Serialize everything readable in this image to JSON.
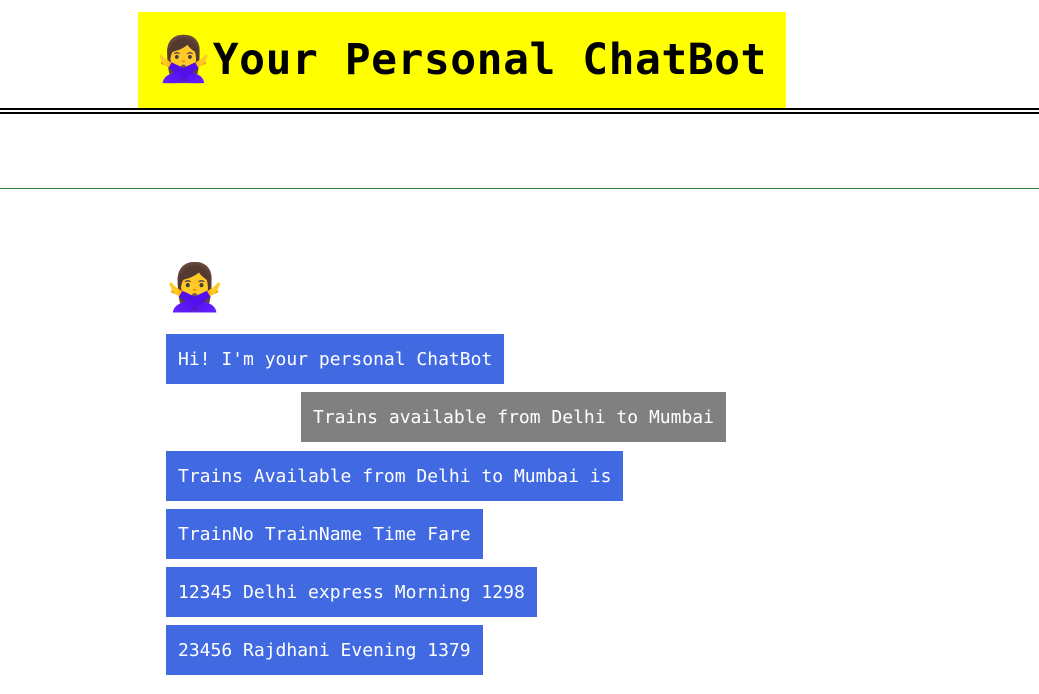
{
  "header": {
    "emoji": "🙅‍♀️",
    "title": "Your Personal ChatBot",
    "background_color": "#ffff00"
  },
  "chat": {
    "bot_avatar": "🙅‍♀️",
    "bot_bubble_color": "#4169e1",
    "user_bubble_color": "#808080",
    "messages": [
      {
        "sender": "bot",
        "text": "Hi! I'm your personal ChatBot"
      },
      {
        "sender": "user",
        "text": "Trains available from Delhi to Mumbai"
      },
      {
        "sender": "bot",
        "text": "Trains Available from Delhi to Mumbai is"
      },
      {
        "sender": "bot",
        "text": "TrainNo TrainName Time Fare"
      },
      {
        "sender": "bot",
        "text": "12345 Delhi express Morning 1298"
      },
      {
        "sender": "bot",
        "text": "23456 Rajdhani Evening 1379"
      }
    ]
  }
}
